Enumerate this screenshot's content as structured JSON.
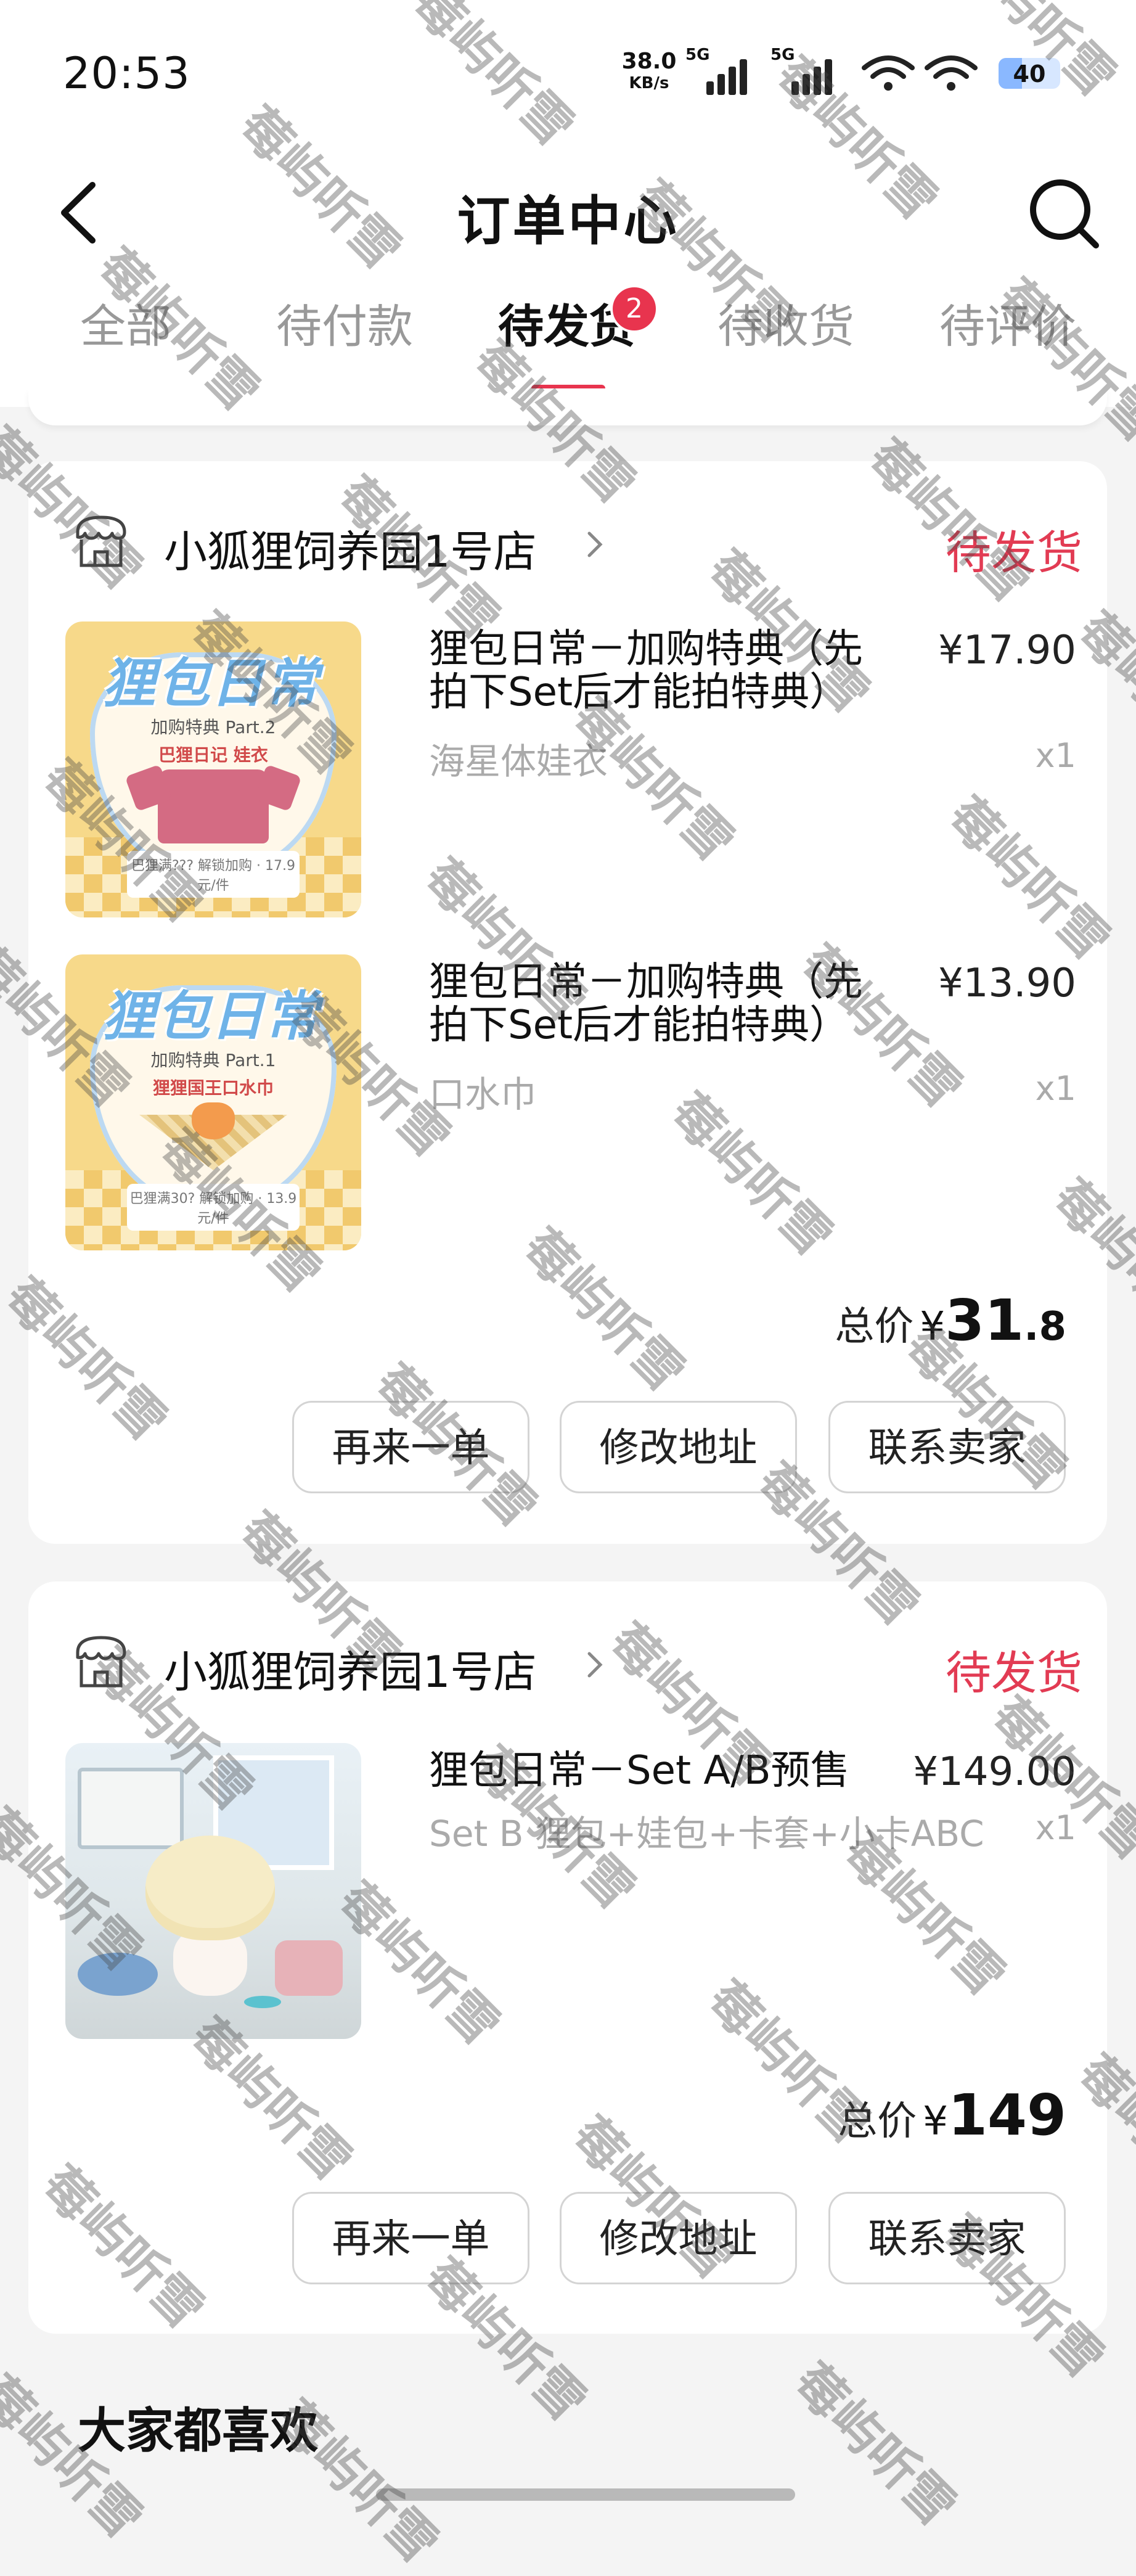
{
  "status_bar": {
    "time": "20:53",
    "net_speed_value": "38.0",
    "net_speed_unit": "KB/s",
    "sim1_tag": "5G",
    "sim2_tag": "5G",
    "battery_level": "40"
  },
  "header": {
    "title": "订单中心",
    "back_icon": "back-arrow-icon",
    "search_icon": "search-icon"
  },
  "tabs": [
    {
      "label": "全部"
    },
    {
      "label": "待付款"
    },
    {
      "label": "待发货",
      "active": true,
      "badge": "2"
    },
    {
      "label": "待收货"
    },
    {
      "label": "待评价"
    }
  ],
  "orders": [
    {
      "shop_name": "小狐狸饲养园1号店",
      "status": "待发货",
      "items": [
        {
          "title": "狸包日常－加购特典（先拍下Set后才能拍特典）",
          "price": "¥17.90",
          "variant": "海星体娃衣",
          "qty": "x1",
          "thumb": {
            "heading": "狸包日常",
            "line1": "加购特典 Part.2",
            "line2": "巴狸日记 娃衣",
            "footer": "巴狸满??? 解锁加购 · 17.9元/件"
          }
        },
        {
          "title": "狸包日常－加购特典（先拍下Set后才能拍特典）",
          "price": "¥13.90",
          "variant": "口水巾",
          "qty": "x1",
          "thumb": {
            "heading": "狸包日常",
            "line1": "加购特典 Part.1",
            "line2": "狸狸国王口水巾",
            "footer": "巴狸满30? 解锁加购 · 13.9元/件"
          }
        }
      ],
      "total_label": "总价",
      "total_currency": "¥",
      "total_int": "31",
      "total_dec": ".8",
      "buttons": [
        "再来一单",
        "修改地址",
        "联系卖家"
      ]
    },
    {
      "shop_name": "小狐狸饲养园1号店",
      "status": "待发货",
      "items": [
        {
          "title": "狸包日常－Set A/B预售",
          "price": "¥149.00",
          "variant": "Set B 狸包+娃包+卡套+小卡ABC",
          "qty": "x1"
        }
      ],
      "total_label": "总价",
      "total_currency": "¥",
      "total_int": "149",
      "total_dec": "",
      "buttons": [
        "再来一单",
        "修改地址",
        "联系卖家"
      ]
    }
  ],
  "recommend": {
    "title": "大家都喜欢"
  },
  "watermark_text": "莓屿听雪",
  "colors": {
    "accent": "#e8344e",
    "status": "#e23b53",
    "background": "#f4f4f4"
  }
}
